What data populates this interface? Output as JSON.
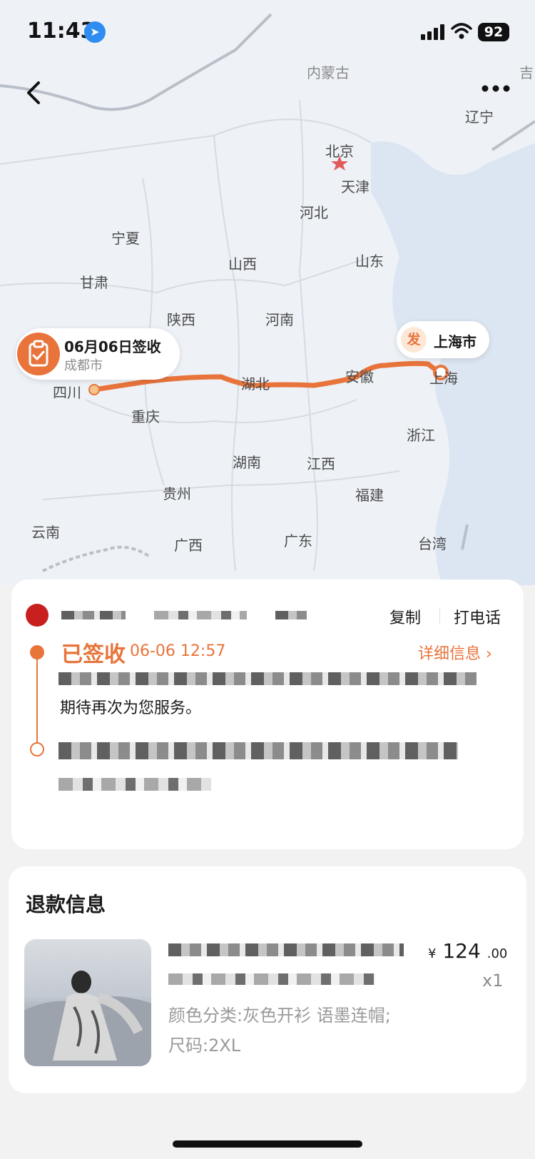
{
  "status_bar": {
    "time": "11:43",
    "battery": "92",
    "location_icon": "location-arrow-icon",
    "signal_icon": "cellular-signal-icon",
    "wifi_icon": "wifi-icon"
  },
  "nav": {
    "back_icon": "chevron-left-icon",
    "more_icon": "more-dots-icon"
  },
  "map": {
    "provinces": [
      "内蒙古",
      "吉",
      "辽宁",
      "北京",
      "天津",
      "河北",
      "宁夏",
      "山西",
      "山东",
      "甘肃",
      "陕西",
      "河南",
      "四川",
      "湖北",
      "安徽",
      "上海",
      "重庆",
      "浙江",
      "湖南",
      "江西",
      "福建",
      "贵州",
      "云南",
      "广西",
      "广东",
      "台湾"
    ],
    "sign_marker": {
      "title": "06月06日签收",
      "city": "成都市",
      "icon": "clipboard-check-icon"
    },
    "ship_marker": {
      "badge": "发",
      "city": "上海市"
    }
  },
  "logistics": {
    "copy_label": "复制",
    "call_label": "打电话",
    "status": "已签收",
    "status_time": "06-06 12:57",
    "detail_link": "详细信息",
    "service_text": "期待再次为您服务。"
  },
  "refund": {
    "title": "退款信息",
    "price_currency": "¥",
    "price_int": "124",
    "price_dec": ".00",
    "qty": "x1",
    "sku": "颜色分类:灰色开衫 语墨连帽;尺码:2XL"
  },
  "colors": {
    "accent": "#e8743b",
    "route": "#e8743b"
  }
}
